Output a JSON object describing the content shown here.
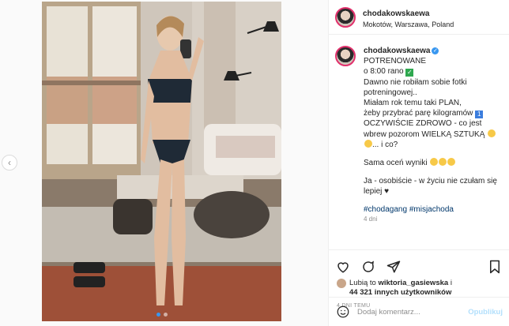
{
  "post": {
    "username": "chodakowskaewa",
    "location": "Mokotów, Warszawa, Poland",
    "verified": true,
    "caption_lines": [
      "POTRENOWANE",
      "o 8:00 rano",
      "Dawno nie robiłam sobie fotki",
      "potreningowej..",
      "Miałam rok temu taki PLAN,",
      "żeby przybrać parę kilogramów",
      "OCZYWIŚCIE ZDROWO - co jest",
      "wbrew pozorom WIELKĄ SZTUKĄ",
      "... i co?",
      "Sama oceń wyniki",
      "Ja - osobiście - w życiu nie czułam się",
      "lepiej ♥"
    ],
    "hashtags": "#chodagang #misjachoda",
    "age": "4 dni",
    "likes_line1": "Lubią to",
    "likes_user": "wiktoria_gasiewska",
    "likes_and": "i",
    "likes_count": "44 321 innych użytkowników",
    "time_label": "4 DNI TEMU",
    "comment_placeholder": "Dodaj komentarz...",
    "post_button": "Opublikuj",
    "carousel_index": 0,
    "carousel_count": 2
  },
  "colors": {
    "accent": "#3897f0",
    "link": "#00376b",
    "muted": "#8e8e8e",
    "post_disabled": "#b2dffc"
  },
  "icons": [
    "heart-icon",
    "comment-icon",
    "share-icon",
    "bookmark-icon",
    "smile-icon",
    "chevron-left-icon",
    "verified-icon"
  ]
}
